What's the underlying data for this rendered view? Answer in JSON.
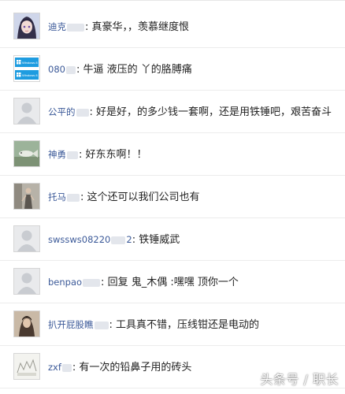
{
  "comments": [
    {
      "user_prefix": "迪克",
      "user_suffix": "",
      "separator": ":",
      "text": "真豪华，，羡慕继度恨"
    },
    {
      "user_prefix": "080",
      "user_suffix": "",
      "separator": ":",
      "text": "牛逼 液压的 丫的胳膊痛"
    },
    {
      "user_prefix": "公平的",
      "user_suffix": "",
      "separator": ":",
      "text": "好是好，的多少钱一套啊，还是用铁锤吧，艰苦奋斗"
    },
    {
      "user_prefix": "神勇",
      "user_suffix": "",
      "separator": ":",
      "text": "好东东啊！！"
    },
    {
      "user_prefix": "托马",
      "user_suffix": "",
      "separator": ":",
      "text": "这个还可以我们公司也有"
    },
    {
      "user_prefix": "swssws08220",
      "user_suffix": "2",
      "separator": ":",
      "text": "铁锤威武"
    },
    {
      "user_prefix": "benpao",
      "user_suffix": "",
      "separator": ":",
      "text": "回复 鬼_木偶 :嘿嘿 顶你一个"
    },
    {
      "user_prefix": "扒开屁股瞧",
      "user_suffix": "",
      "separator": ":",
      "text": "工具真不错，压线钳还是电动的"
    },
    {
      "user_prefix": "zxf",
      "user_suffix": "",
      "separator": ":",
      "text": "有一次的铅鼻子用的砖头"
    }
  ],
  "avatar_windows_label": "Windows 8",
  "watermark": "头条号 / 职长"
}
